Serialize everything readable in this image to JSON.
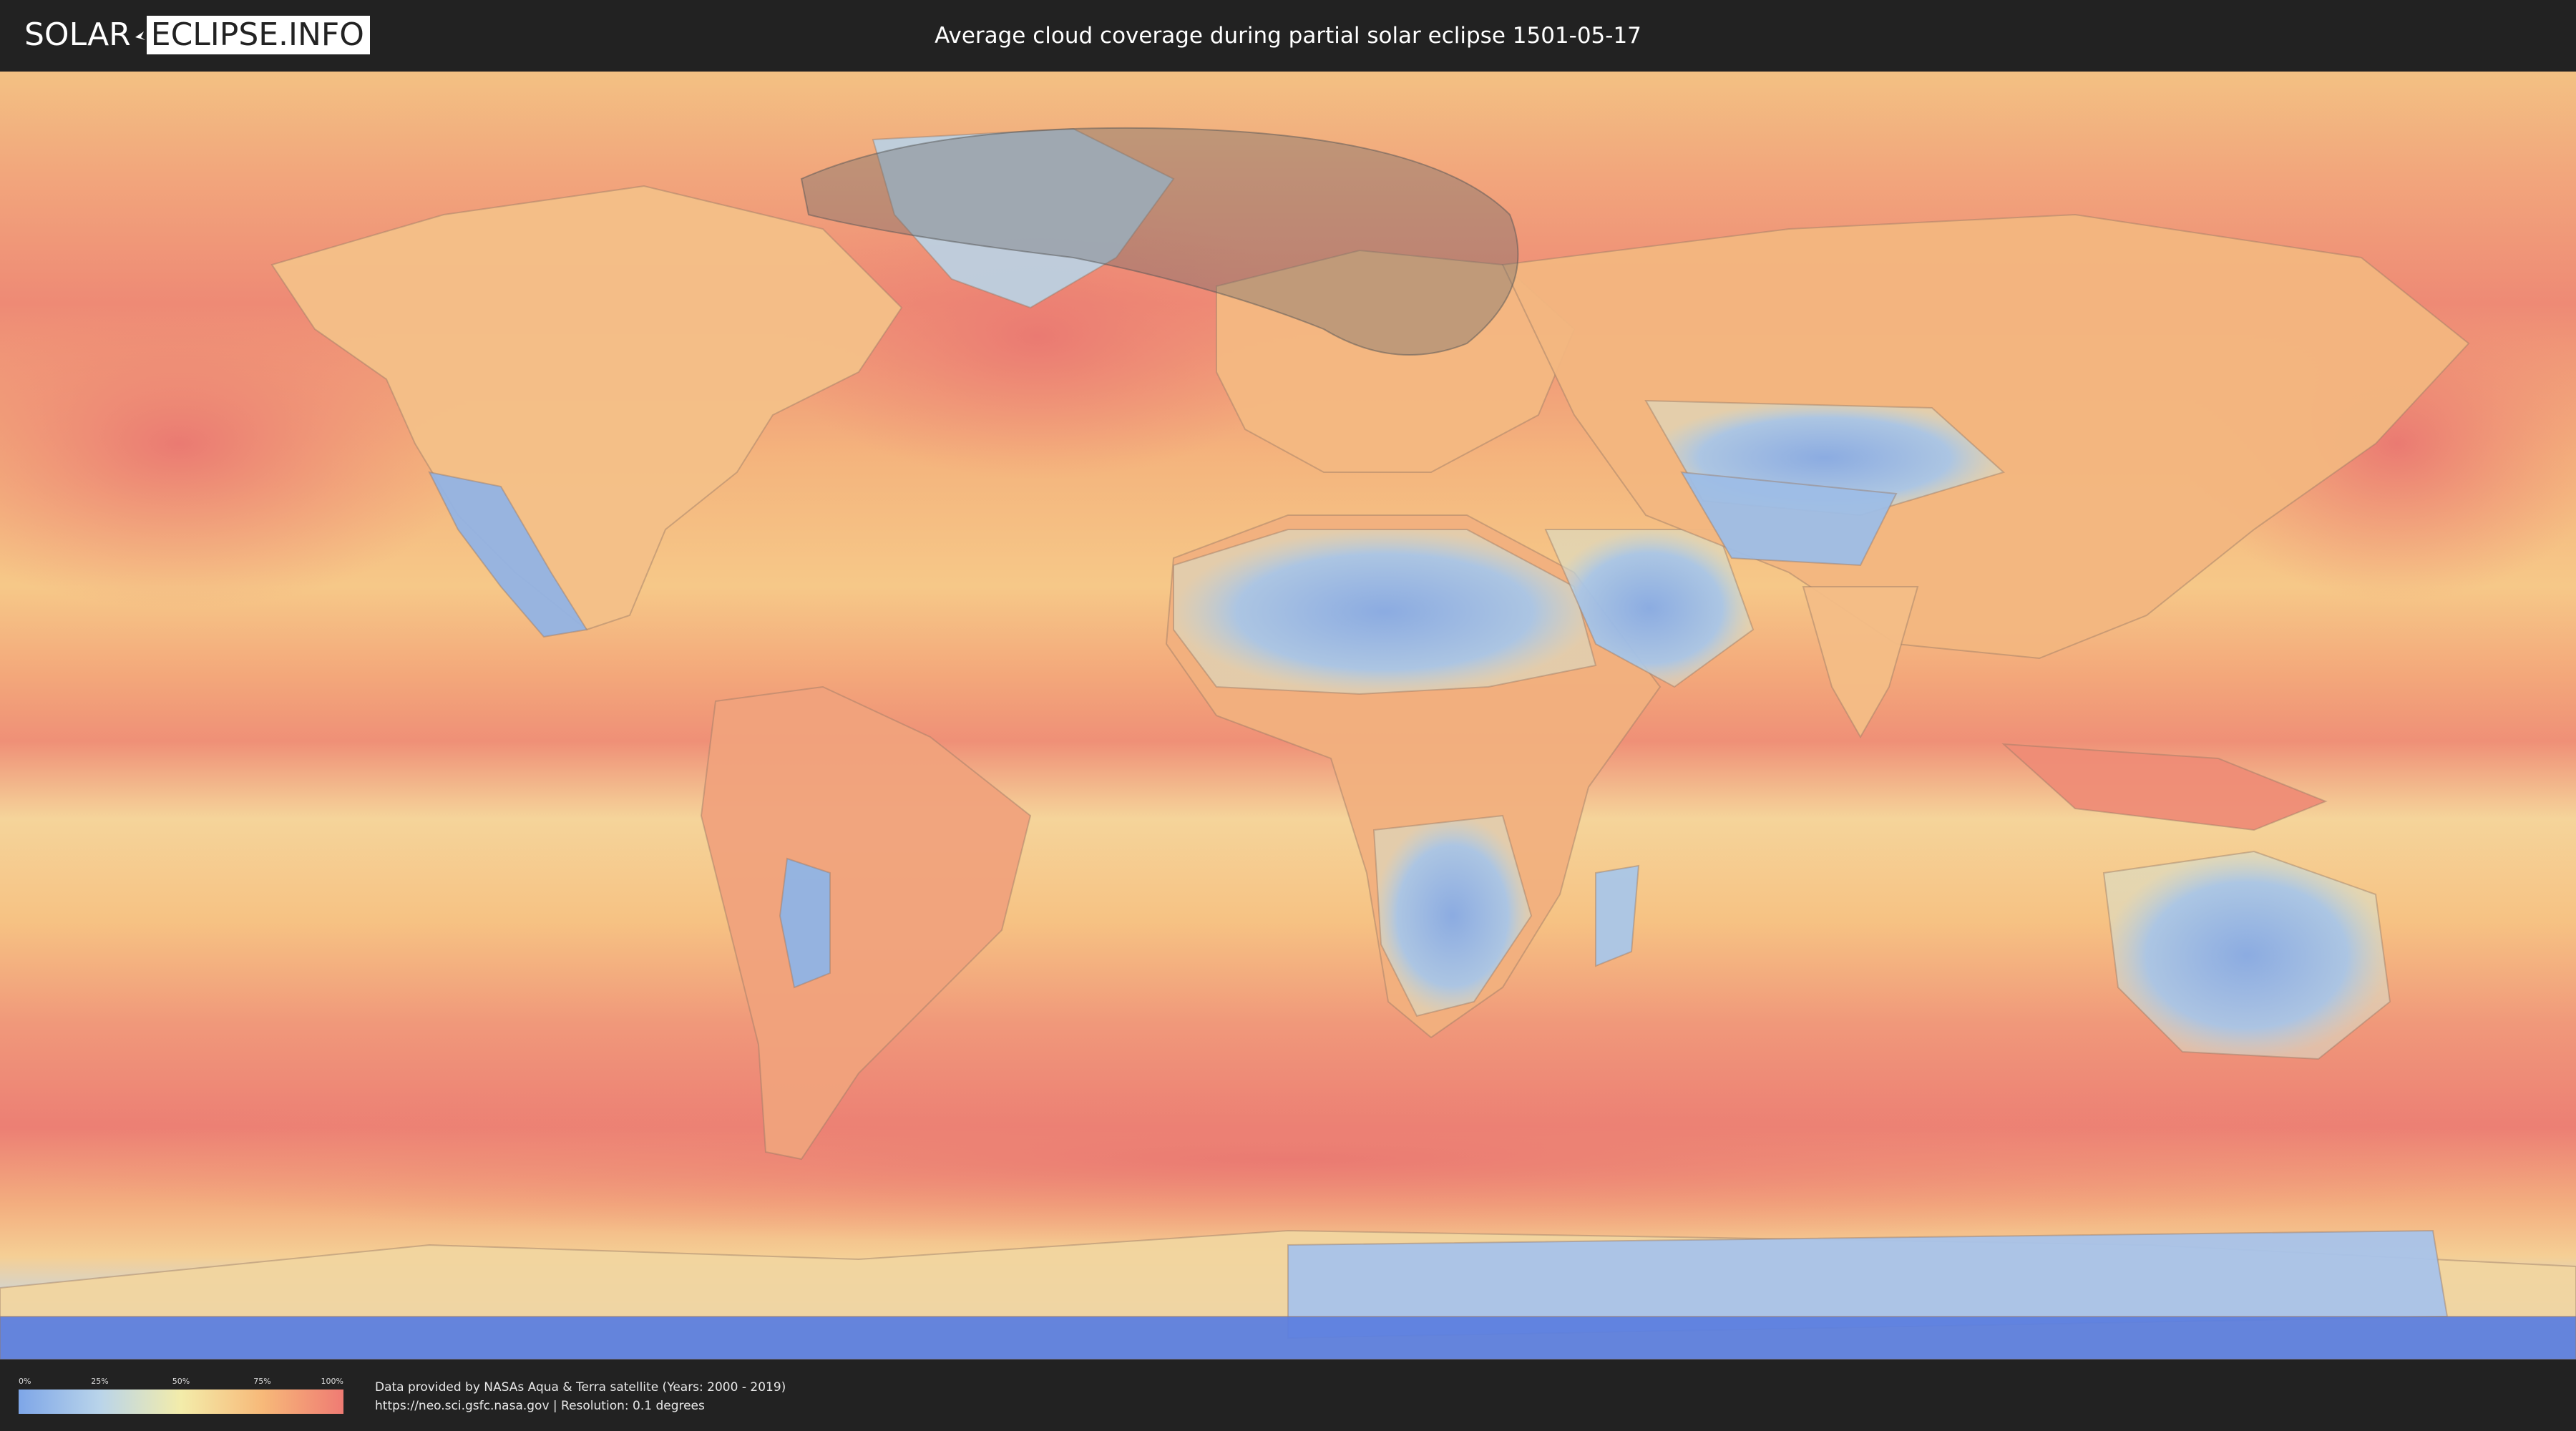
{
  "header": {
    "logo_left": "SOLAR",
    "logo_right": "ECLIPSE.INFO",
    "title": "Average cloud coverage during partial solar eclipse 1501-05-17"
  },
  "map": {
    "colors": {
      "ocean_cloudy": "#ef8b74",
      "mid": "#f6c27f",
      "clear": "#8fb5e8",
      "very_clear": "#5a7fe0",
      "eclipse_overlay": "#6b6b6b"
    }
  },
  "legend": {
    "ticks": [
      "0%",
      "25%",
      "50%",
      "75%",
      "100%"
    ]
  },
  "credits": {
    "line1": "Data provided by NASAs Aqua & Terra satellite (Years: 2000 - 2019)",
    "line2": "https://neo.sci.gsfc.nasa.gov | Resolution: 0.1 degrees"
  }
}
